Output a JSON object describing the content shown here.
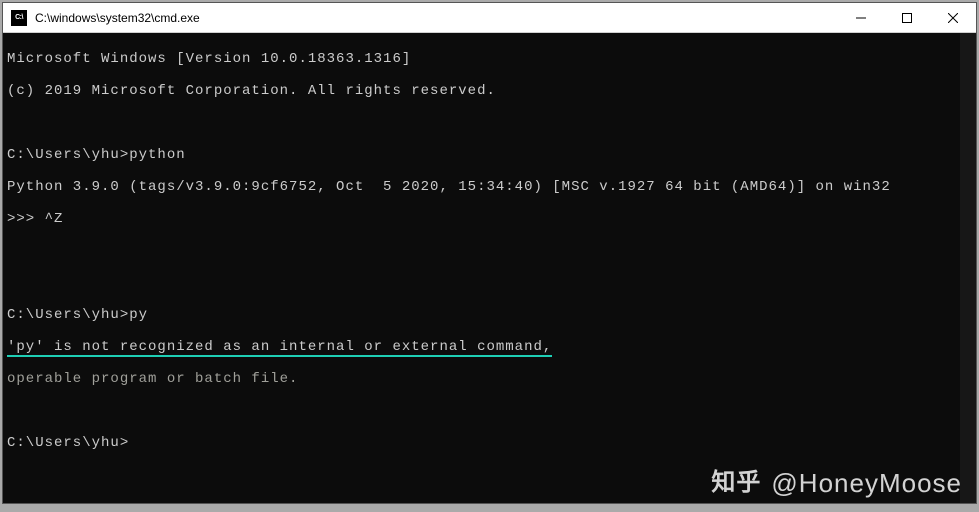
{
  "window": {
    "icon_label": "C:\\",
    "title": "C:\\windows\\system32\\cmd.exe"
  },
  "terminal": {
    "line0": "Microsoft Windows [Version 10.0.18363.1316]",
    "line1": "(c) 2019 Microsoft Corporation. All rights reserved.",
    "blank1": "",
    "prompt1": "C:\\Users\\yhu>",
    "cmd1": "python",
    "python_banner": "Python 3.9.0 (tags/v3.9.0:9cf6752, Oct  5 2020, 15:34:40) [MSC v.1927 64 bit (AMD64)] on win32",
    "python_prompt": ">>> ",
    "python_exit": "^Z",
    "blank2": "",
    "blank3": "",
    "prompt2": "C:\\Users\\yhu>",
    "cmd2": "py",
    "error_line1": "'py' is not recognized as an internal or external command,",
    "error_line2": "operable program or batch file.",
    "blank4": "",
    "prompt3": "C:\\Users\\yhu>"
  },
  "watermark": {
    "logo": "知乎",
    "handle": "@HoneyMoose"
  }
}
